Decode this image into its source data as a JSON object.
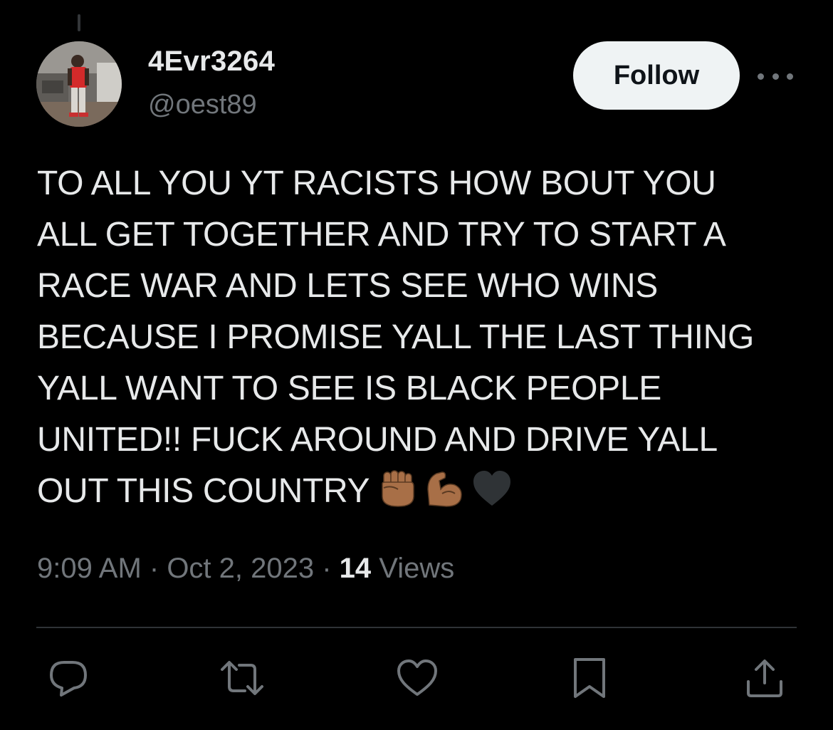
{
  "tweet": {
    "author": {
      "display_name": "4Evr3264",
      "handle": "@oest89"
    },
    "follow_label": "Follow",
    "text_lines": [
      "TO ALL YOU YT  RACISTS HOW BOUT YOU",
      "ALL GET TOGETHER AND TRY TO START A",
      "RACE WAR AND LETS SEE WHO WINS",
      "BECAUSE I PROMISE YALL THE LAST THING",
      "YALL WANT TO SEE IS BLACK PEOPLE",
      "UNITED!! FUCK AROUND AND DRIVE YALL",
      "OUT THIS COUNTRY"
    ],
    "emojis": [
      "raised-fist-emoji",
      "flexed-biceps-emoji",
      "black-heart-emoji"
    ],
    "meta": {
      "time": "9:09 AM",
      "separator": " · ",
      "date": "Oct 2, 2023",
      "views_count": "14",
      "views_label": " Views"
    },
    "actions": [
      "reply-icon",
      "retweet-icon",
      "like-icon",
      "bookmark-icon",
      "share-icon"
    ]
  },
  "colors": {
    "background": "#000000",
    "text_primary": "#e7e9ea",
    "text_secondary": "#71767b",
    "follow_bg": "#eff3f4",
    "divider": "#2f3336",
    "emoji_skin": "#a86f47",
    "emoji_heart": "#2f3336"
  }
}
